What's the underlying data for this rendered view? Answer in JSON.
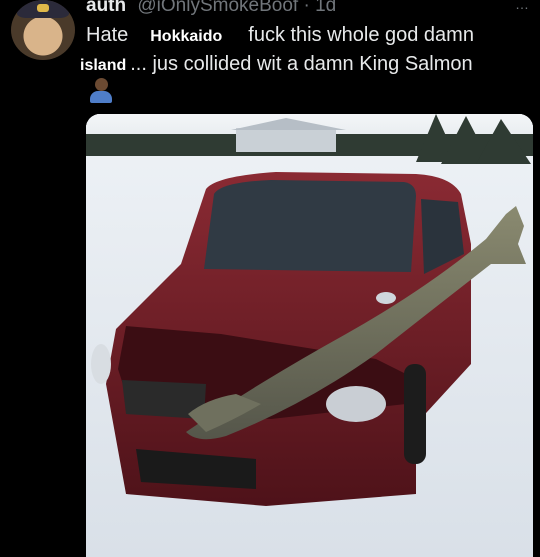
{
  "tweet": {
    "author": {
      "display_name": "auth",
      "handle": "@iOnlySmokeBoof",
      "separator": "·",
      "time": "1d"
    },
    "text": {
      "word_hate": "Hate",
      "tag_hokkaido": "Hokkaido",
      "phrase_1": "fuck this whole god damn",
      "tag_island": "island",
      "phrase_2": "... jus collided wit a damn King Salmon"
    },
    "more_icon": "…"
  },
  "colors": {
    "background": "#000000",
    "text": "#e7e9ea",
    "muted": "#71767b",
    "car": "#6e1f27",
    "snow": "#e9eef3"
  },
  "icons": [
    "more-icon",
    "avatar",
    "small-avatar"
  ]
}
